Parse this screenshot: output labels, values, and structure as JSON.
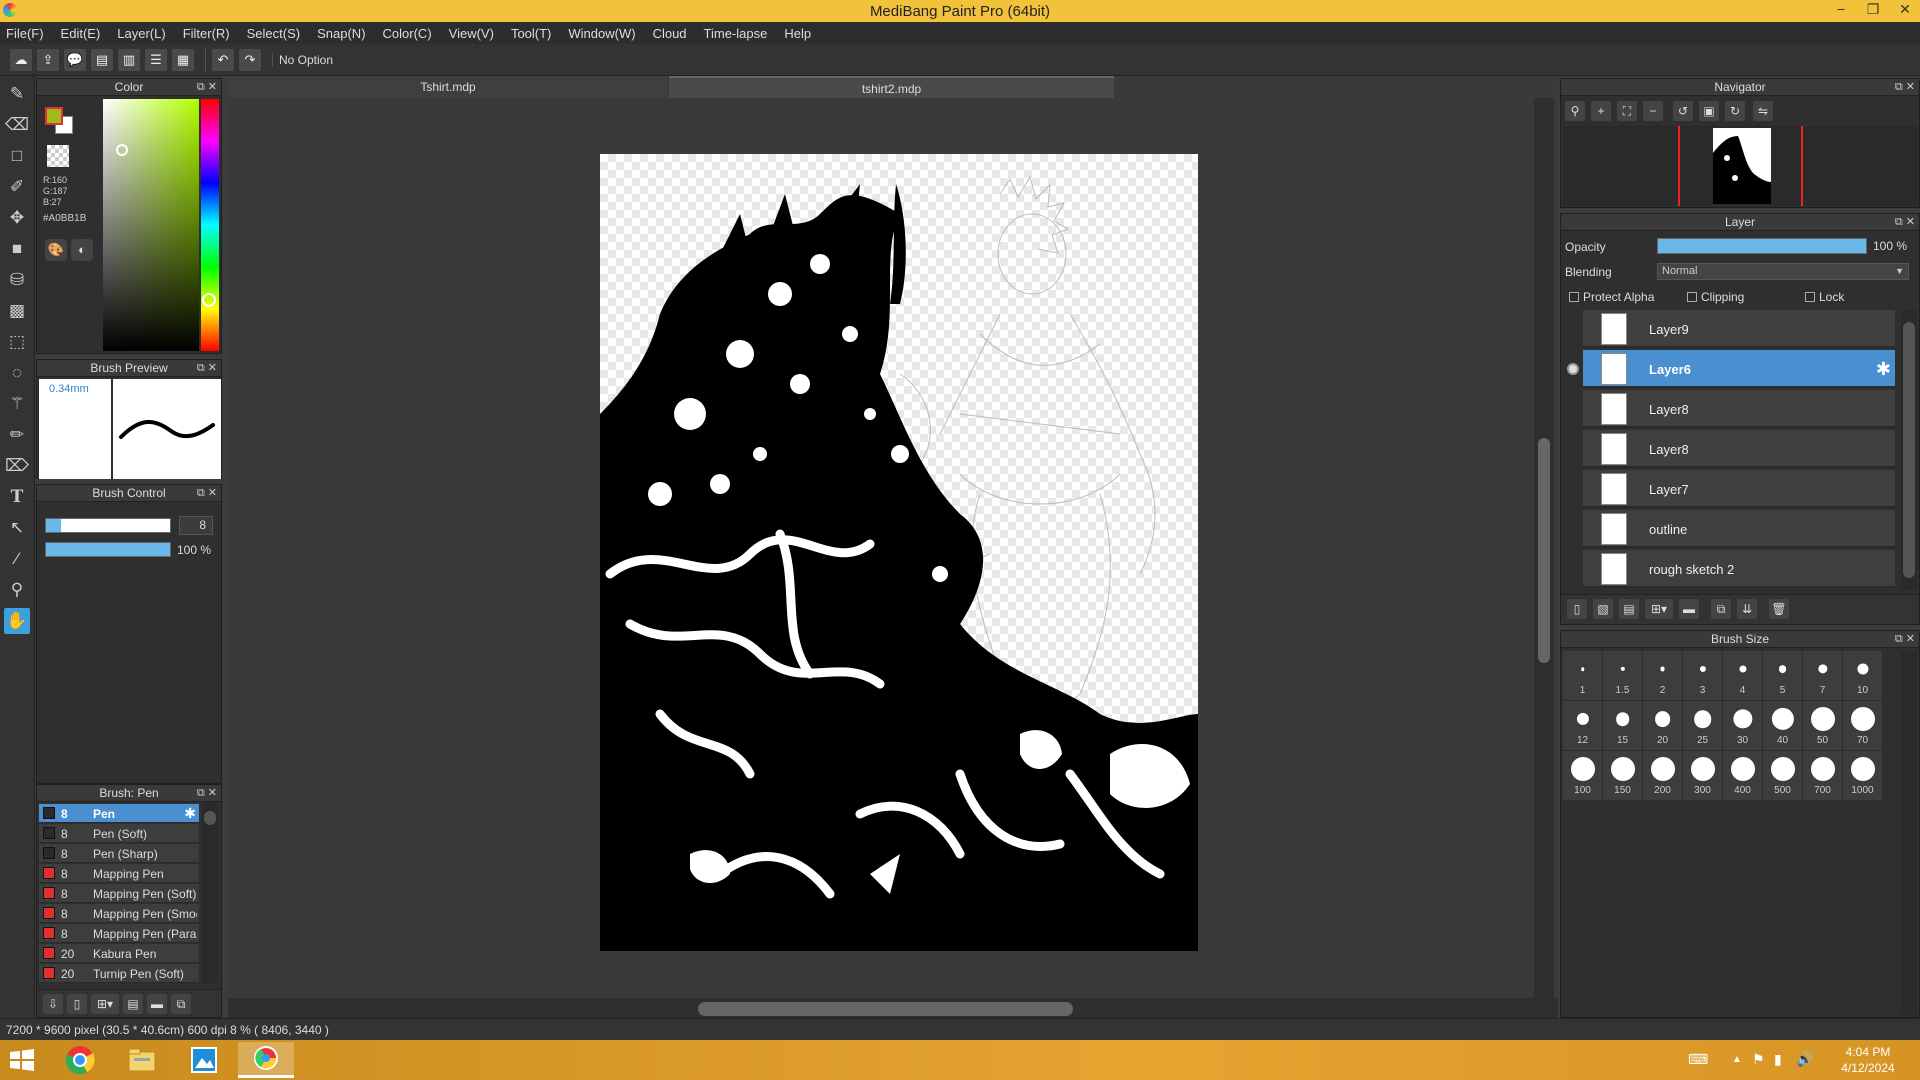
{
  "window": {
    "title": "MediBang Paint Pro (64bit)",
    "controls": {
      "minimize": "−",
      "restore": "❐",
      "close": "✕"
    }
  },
  "menu": [
    "File(F)",
    "Edit(E)",
    "Layer(L)",
    "Filter(R)",
    "Select(S)",
    "Snap(N)",
    "Color(C)",
    "View(V)",
    "Tool(T)",
    "Window(W)",
    "Cloud",
    "Time-lapse",
    "Help"
  ],
  "toolbar": {
    "option_text": "No Option"
  },
  "color_panel": {
    "title": "Color",
    "rgb_r": "R:160",
    "rgb_g": "G:187",
    "rgb_b": "B:27",
    "hex": "#A0BB1B",
    "foreground_color": "#a0bb1b"
  },
  "brush_preview": {
    "title": "Brush Preview",
    "size_label": "0.34mm"
  },
  "brush_control": {
    "title": "Brush Control",
    "size_value": "8",
    "opacity_value": "100 %",
    "size_fraction": 0.12,
    "opacity_fraction": 1.0
  },
  "brush_list": {
    "title": "Brush: Pen",
    "items": [
      {
        "size": "8",
        "name": "Pen",
        "color": "#2a2a2a",
        "selected": true
      },
      {
        "size": "8",
        "name": "Pen (Soft)",
        "color": "#2a2a2a"
      },
      {
        "size": "8",
        "name": "Pen (Sharp)",
        "color": "#2a2a2a"
      },
      {
        "size": "8",
        "name": "Mapping Pen",
        "color": "#e03030"
      },
      {
        "size": "8",
        "name": "Mapping Pen (Soft)",
        "color": "#e03030"
      },
      {
        "size": "8",
        "name": "Mapping Pen (Smoc",
        "color": "#e03030"
      },
      {
        "size": "8",
        "name": "Mapping Pen (Paralle",
        "color": "#e03030"
      },
      {
        "size": "20",
        "name": "Kabura Pen",
        "color": "#e03030"
      },
      {
        "size": "20",
        "name": "Turnip Pen (Soft)",
        "color": "#e03030"
      }
    ]
  },
  "tabs": [
    "Tshirt.mdp",
    "tshirt2.mdp"
  ],
  "navigator": {
    "title": "Navigator"
  },
  "layer_panel": {
    "title": "Layer",
    "opacity_label": "Opacity",
    "opacity_value": "100 %",
    "opacity_fraction": 1.0,
    "blending_label": "Blending",
    "blending_value": "Normal",
    "protect_alpha": "Protect Alpha",
    "clipping": "Clipping",
    "lock": "Lock",
    "layers": [
      {
        "name": "Layer9"
      },
      {
        "name": "Layer6",
        "selected": true,
        "visible": true
      },
      {
        "name": "Layer8"
      },
      {
        "name": "Layer8"
      },
      {
        "name": "Layer7"
      },
      {
        "name": "outline"
      },
      {
        "name": "rough sketch 2"
      }
    ]
  },
  "brush_size": {
    "title": "Brush Size",
    "sizes": [
      "1",
      "1.5",
      "2",
      "3",
      "4",
      "5",
      "7",
      "10",
      "12",
      "15",
      "20",
      "25",
      "30",
      "40",
      "50",
      "70",
      "100",
      "150",
      "200",
      "300",
      "400",
      "500",
      "700",
      "1000"
    ]
  },
  "status": {
    "text": "7200 * 9600 pixel   (30.5 * 40.6cm)   600 dpi   8 %   ( 8406, 3440 )"
  },
  "taskbar": {
    "time": "4:04 PM",
    "date": "4/12/2024"
  }
}
